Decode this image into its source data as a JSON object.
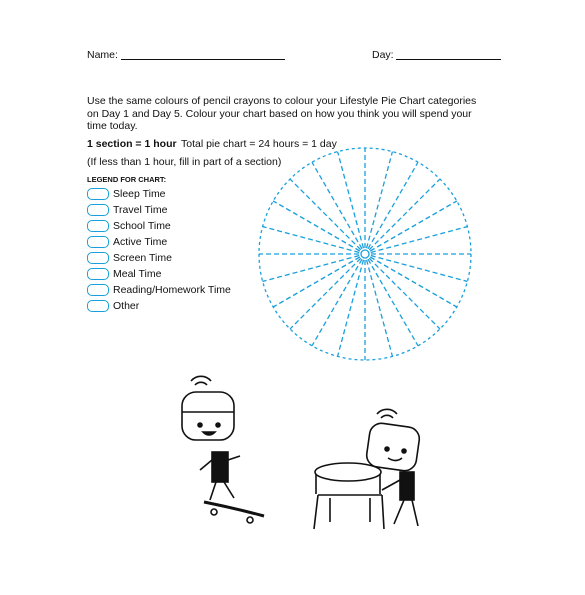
{
  "header": {
    "name_label": "Name:",
    "day_label": "Day:"
  },
  "instructions": {
    "line1": "Use the same colours of pencil crayons to colour your Lifestyle Pie Chart categories",
    "line2": "on Day 1 and Day 5. Colour your chart based on how you think you will spend your",
    "line3": "time today.",
    "section_bold": "1 section = 1 hour",
    "total": "Total pie chart = 24 hours = 1 day",
    "partial": "(If less than 1 hour, fill in part of a section)"
  },
  "legend": {
    "title": "LEGEND FOR CHART:",
    "items": [
      "Sleep Time",
      "Travel Time",
      "School Time",
      "Active Time",
      "Screen Time",
      "Meal Time",
      "Reading/Homework Time",
      "Other"
    ]
  },
  "pie": {
    "sections": 24,
    "line_color": "#1aa0dc"
  }
}
